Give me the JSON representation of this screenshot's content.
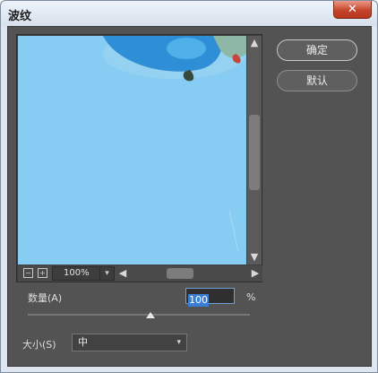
{
  "window": {
    "title": "波纹",
    "close_icon": "close-icon"
  },
  "preview": {
    "zoom_out_glyph": "−",
    "zoom_in_glyph": "+",
    "zoom_level": "100%",
    "scroll_up": "▲",
    "scroll_down": "▼",
    "scroll_left": "◀",
    "scroll_right": "▶",
    "dropdown_glyph": "▾"
  },
  "buttons": {
    "ok_label": "确定",
    "default_label": "默认"
  },
  "params": {
    "amount_label": "数量(A)",
    "amount_value": "100",
    "amount_unit": "%",
    "size_label": "大小(S)",
    "size_value": "中",
    "dropdown_glyph": "▾"
  },
  "colors": {
    "dialog_bg": "#535353",
    "preview_sky": "#87ccf2",
    "accent": "#3a7fd5"
  }
}
